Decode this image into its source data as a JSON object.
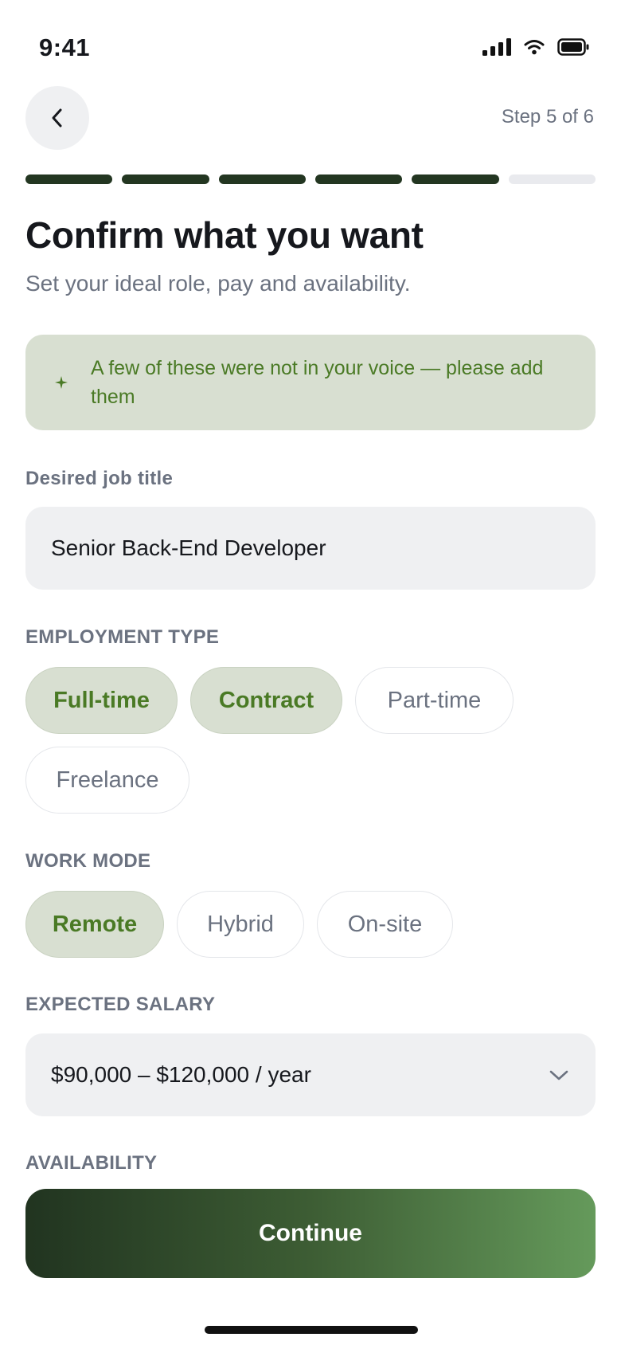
{
  "status_bar": {
    "time": "9:41",
    "icons": [
      "cellular-signal-icon",
      "wifi-icon",
      "battery-icon"
    ]
  },
  "header": {
    "back_icon": "chevron-left-icon",
    "step_label": "Step 5 of 6"
  },
  "progress": {
    "current_step": 5,
    "total_steps": 6,
    "color_done": "#233621",
    "color_pending": "#e9eaee"
  },
  "page": {
    "title": "Confirm what you want",
    "subtitle": "Set your ideal role, pay and availability."
  },
  "notice": {
    "icon": "sparkle-icon",
    "text": "A few of these were not in your voice — please add them"
  },
  "job_title": {
    "label": "Desired job title",
    "value": "Senior Back-End Developer"
  },
  "employment_type": {
    "label": "EMPLOYMENT TYPE",
    "options": [
      {
        "label": "Full-time",
        "selected": true
      },
      {
        "label": "Contract",
        "selected": true
      },
      {
        "label": "Part-time",
        "selected": false
      },
      {
        "label": "Freelance",
        "selected": false
      }
    ]
  },
  "work_mode": {
    "label": "WORK MODE",
    "options": [
      {
        "label": "Remote",
        "selected": true
      },
      {
        "label": "Hybrid",
        "selected": false
      },
      {
        "label": "On-site",
        "selected": false
      }
    ]
  },
  "salary": {
    "label": "EXPECTED SALARY",
    "value": "$90,000 – $120,000 / year",
    "icon": "chevron-down-icon"
  },
  "availability": {
    "label": "AVAILABILITY"
  },
  "footer": {
    "continue_label": "Continue"
  },
  "colors": {
    "accent_green": "#4a7a25",
    "chip_selected_bg": "#d8dfd1",
    "button_gradient_start": "#213420",
    "button_gradient_end": "#659a5b"
  }
}
